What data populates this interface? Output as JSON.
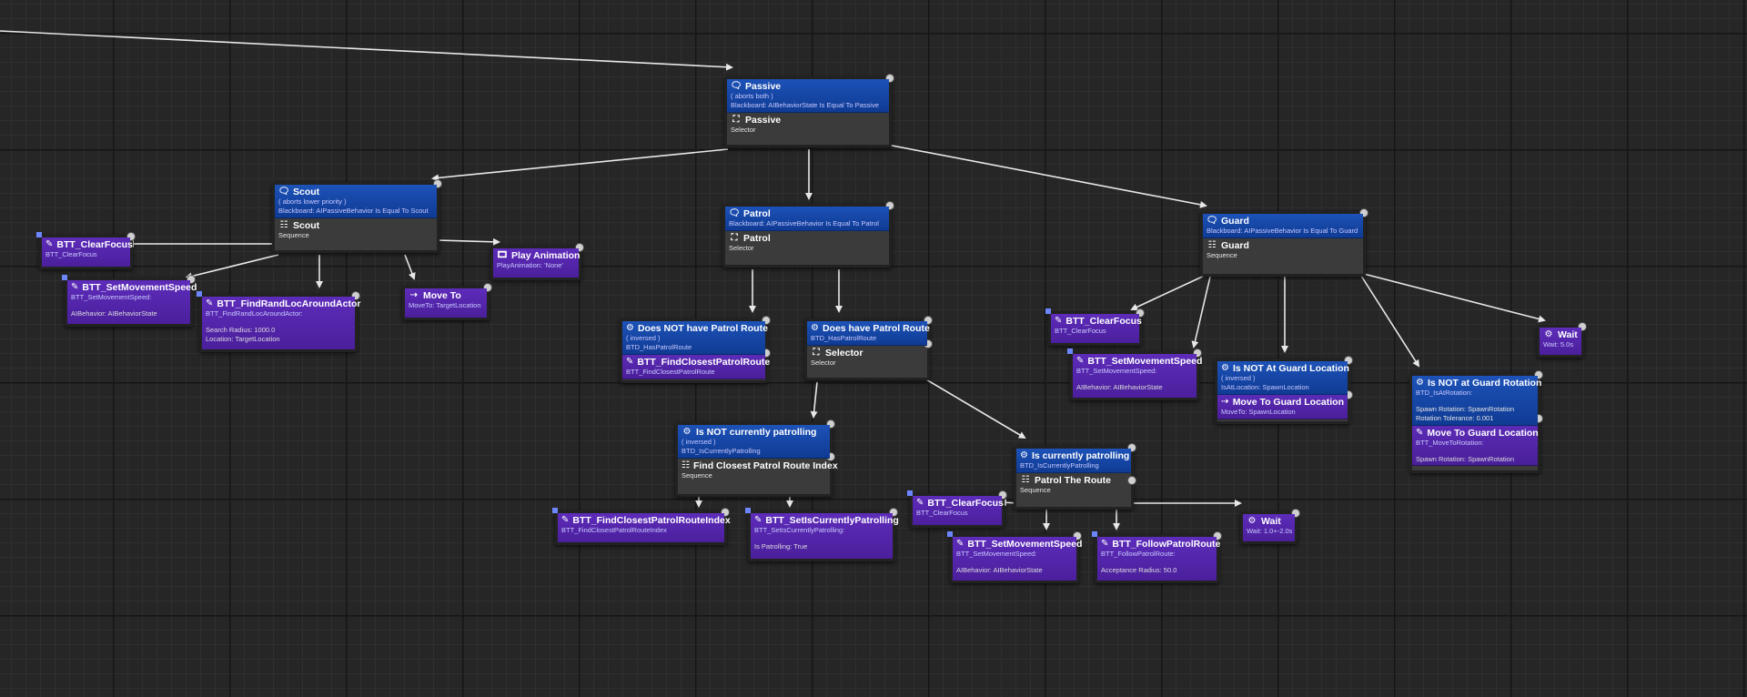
{
  "colors": {
    "decorator": "#1d52b8",
    "task": "#5b2bb6",
    "composite": "#3b3b3b",
    "wire": "#e8e8e8"
  },
  "nodes": {
    "passive": {
      "deco_title": "Passive",
      "deco_note": "( aborts both )",
      "deco_detail": "Blackboard: AIBehaviorState Is Equal To Passive",
      "title": "Passive",
      "type": "Selector"
    },
    "scout": {
      "deco_title": "Scout",
      "deco_note": "( aborts lower priority )",
      "deco_detail": "Blackboard: AIPassiveBehavior Is Equal To Scout",
      "title": "Scout",
      "type": "Sequence"
    },
    "patrol": {
      "deco_title": "Patrol",
      "deco_detail": "Blackboard: AIPassiveBehavior Is Equal To Patrol",
      "title": "Patrol",
      "type": "Selector"
    },
    "guard": {
      "deco_title": "Guard",
      "deco_detail": "Blackboard: AIPassiveBehavior Is Equal To Guard",
      "title": "Guard",
      "type": "Sequence"
    },
    "scout_clear": {
      "title": "BTT_ClearFocus",
      "sub": "BTT_ClearFocus"
    },
    "scout_speed": {
      "title": "BTT_SetMovementSpeed",
      "sub": "BTT_SetMovementSpeed:",
      "line1": "AIBehavior: AIBehaviorState"
    },
    "scout_find": {
      "title": "BTT_FindRandLocAroundActor",
      "sub": "BTT_FindRandLocAroundActor:",
      "line1": "Search Radius: 1000.0",
      "line2": "Location: TargetLocation"
    },
    "scout_move": {
      "title": "Move To",
      "sub": "MoveTo: TargetLocation"
    },
    "scout_anim": {
      "title": "Play Animation",
      "sub": "PlayAnimation: 'None'"
    },
    "no_route": {
      "deco_title": "Does NOT have Patrol Route",
      "deco_note": "( inversed )",
      "deco_detail": "BTD_HasPatrolRoute",
      "title": "BTT_FindClosestPatrolRoute",
      "sub": "BTT_FindClosestPatrolRoute"
    },
    "has_route": {
      "deco_title": "Does have Patrol Route",
      "deco_detail": "BTD_HasPatrolRoute",
      "title": "Selector",
      "type": "Selector"
    },
    "not_patrolling": {
      "deco_title": "Is NOT currently patrolling",
      "deco_note": "( inversed )",
      "deco_detail": "BTD_IsCurrentlyPatrolling",
      "title": "Find Closest Patrol Route Index",
      "type": "Sequence"
    },
    "patrolling": {
      "deco_title": "Is currently patrolling",
      "deco_detail": "BTD_IsCurrentlyPatrolling",
      "title": "Patrol The Route",
      "type": "Sequence"
    },
    "find_index": {
      "title": "BTT_FindClosestPatrolRouteIndex",
      "sub": "BTT_FindClosestPatrolRouteIndex"
    },
    "set_patrolling": {
      "title": "BTT_SetIsCurrentlyPatrolling",
      "sub": "BTT_SetIsCurrentlyPatrolling:",
      "line1": "Is Patrolling: True"
    },
    "patrol_clear": {
      "title": "BTT_ClearFocus",
      "sub": "BTT_ClearFocus"
    },
    "patrol_speed": {
      "title": "BTT_SetMovementSpeed",
      "sub": "BTT_SetMovementSpeed:",
      "line1": "AIBehavior: AIBehaviorState"
    },
    "follow_route": {
      "title": "BTT_FollowPatrolRoute",
      "sub": "BTT_FollowPatrolRoute:",
      "line1": "Acceptance Radius: 50.0"
    },
    "patrol_wait": {
      "title": "Wait",
      "sub": "Wait: 1.0+-2.0s"
    },
    "guard_clear": {
      "title": "BTT_ClearFocus",
      "sub": "BTT_ClearFocus"
    },
    "guard_speed": {
      "title": "BTT_SetMovementSpeed",
      "sub": "BTT_SetMovementSpeed:",
      "line1": "AIBehavior: AIBehaviorState"
    },
    "guard_loc": {
      "deco_title": "Is NOT At Guard Location",
      "deco_note": "( inversed )",
      "deco_detail": "IsAtLocation: SpawnLocation",
      "title": "Move To Guard Location",
      "sub": "MoveTo: SpawnLocation"
    },
    "guard_rot": {
      "deco_title": "Is NOT at Guard Rotation",
      "deco_detail": "BTD_IsAtRotation:",
      "deco_line1": "Spawn Rotation: SpawnRotation",
      "deco_line2": "Rotation Tolerance: 0.001",
      "title": "Move To Guard Location",
      "sub": "BTT_MoveToRotation:",
      "line1": "Spawn Rotation: SpawnRotation"
    },
    "guard_wait": {
      "title": "Wait",
      "sub": "Wait: 5.0s"
    }
  }
}
